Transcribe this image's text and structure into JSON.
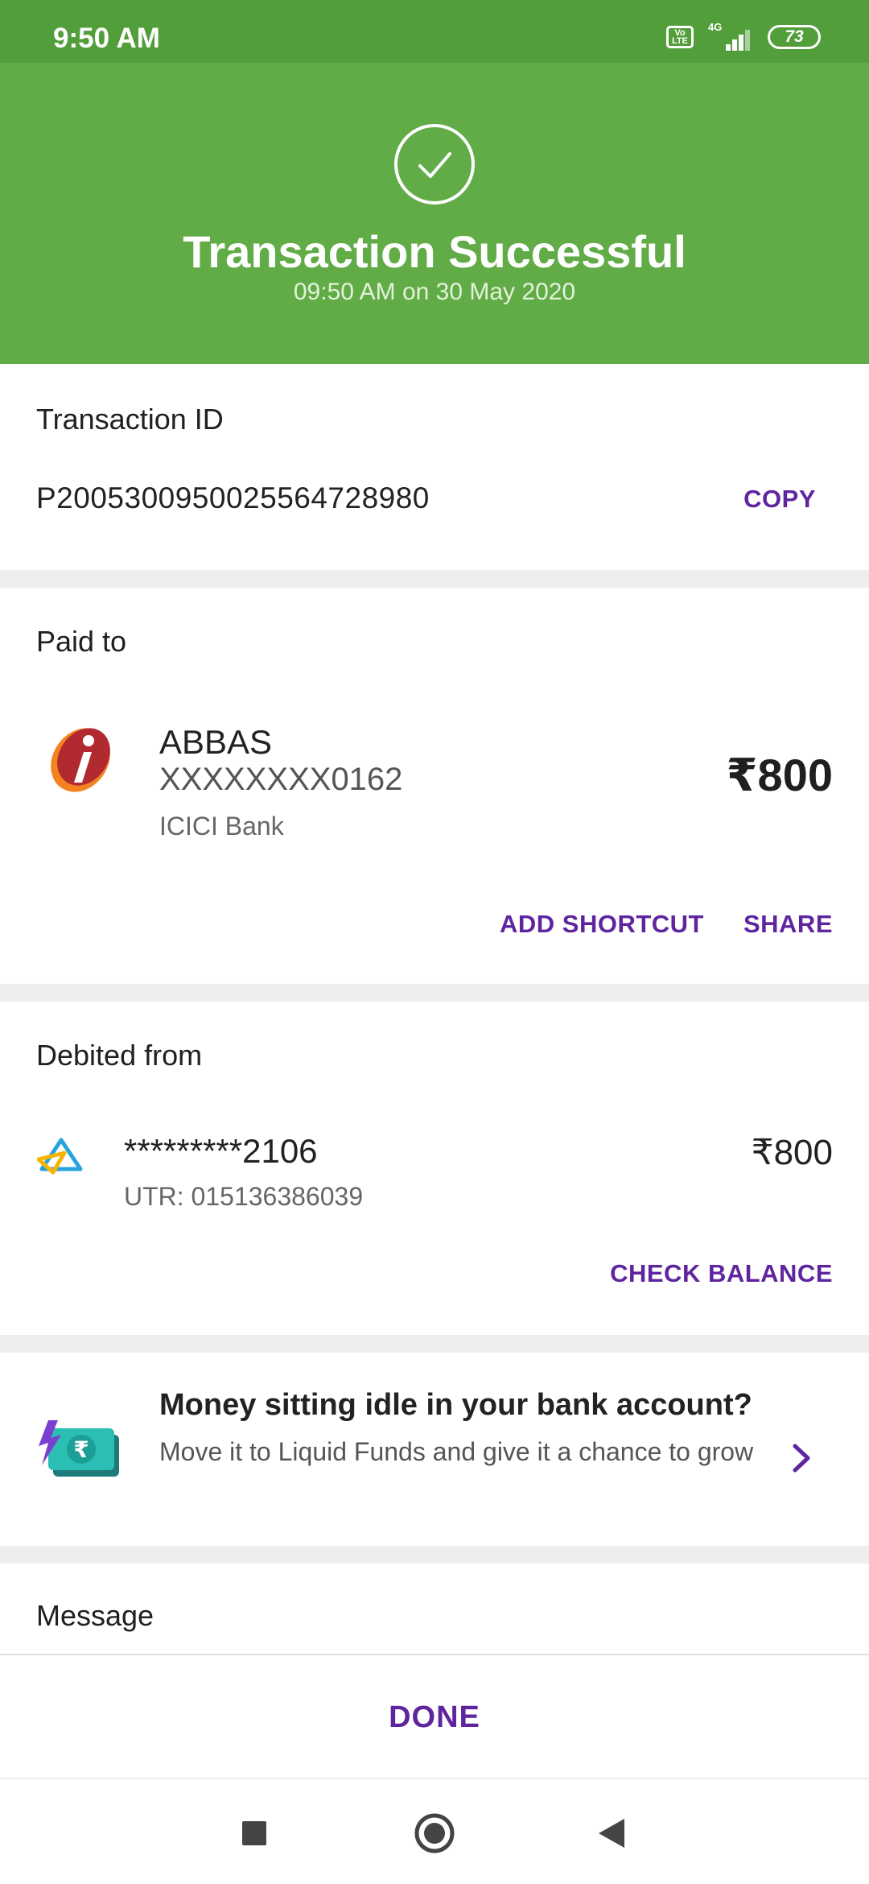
{
  "status_bar": {
    "time": "9:50 AM",
    "volte_label": "Vo LTE",
    "network_label": "4G",
    "battery_level": "73"
  },
  "header": {
    "title": "Transaction Successful",
    "subtitle": "09:50 AM on 30 May 2020",
    "icon": "check-circle-icon",
    "color": "#61ac47"
  },
  "transaction": {
    "heading": "Transaction ID",
    "id": "P2005300950025564728980",
    "copy_label": "COPY"
  },
  "paid_to": {
    "heading": "Paid to",
    "name": "ABBAS",
    "account": "XXXXXXXX0162",
    "bank": "ICICI Bank",
    "amount": "₹800",
    "add_shortcut_label": "ADD SHORTCUT",
    "share_label": "SHARE",
    "bank_icon": "icici-bank-logo"
  },
  "debited_from": {
    "heading": "Debited from",
    "account": "*********2106",
    "utr": "UTR: 015136386039",
    "amount": "₹800",
    "check_balance_label": "CHECK BALANCE",
    "bank_icon": "sbi-bank-logo"
  },
  "promo": {
    "title": "Money sitting idle in your bank account?",
    "body": "Move it to Liquid Funds and give it a chance to grow",
    "icon": "rupee-cash-icon"
  },
  "message": {
    "heading": "Message"
  },
  "footer": {
    "done_label": "DONE"
  },
  "colors": {
    "accent": "#5f259f",
    "success_green": "#61ac47",
    "status_green": "#529e3a"
  },
  "nav": {
    "buttons": [
      "recents-icon",
      "home-icon",
      "back-icon"
    ]
  }
}
